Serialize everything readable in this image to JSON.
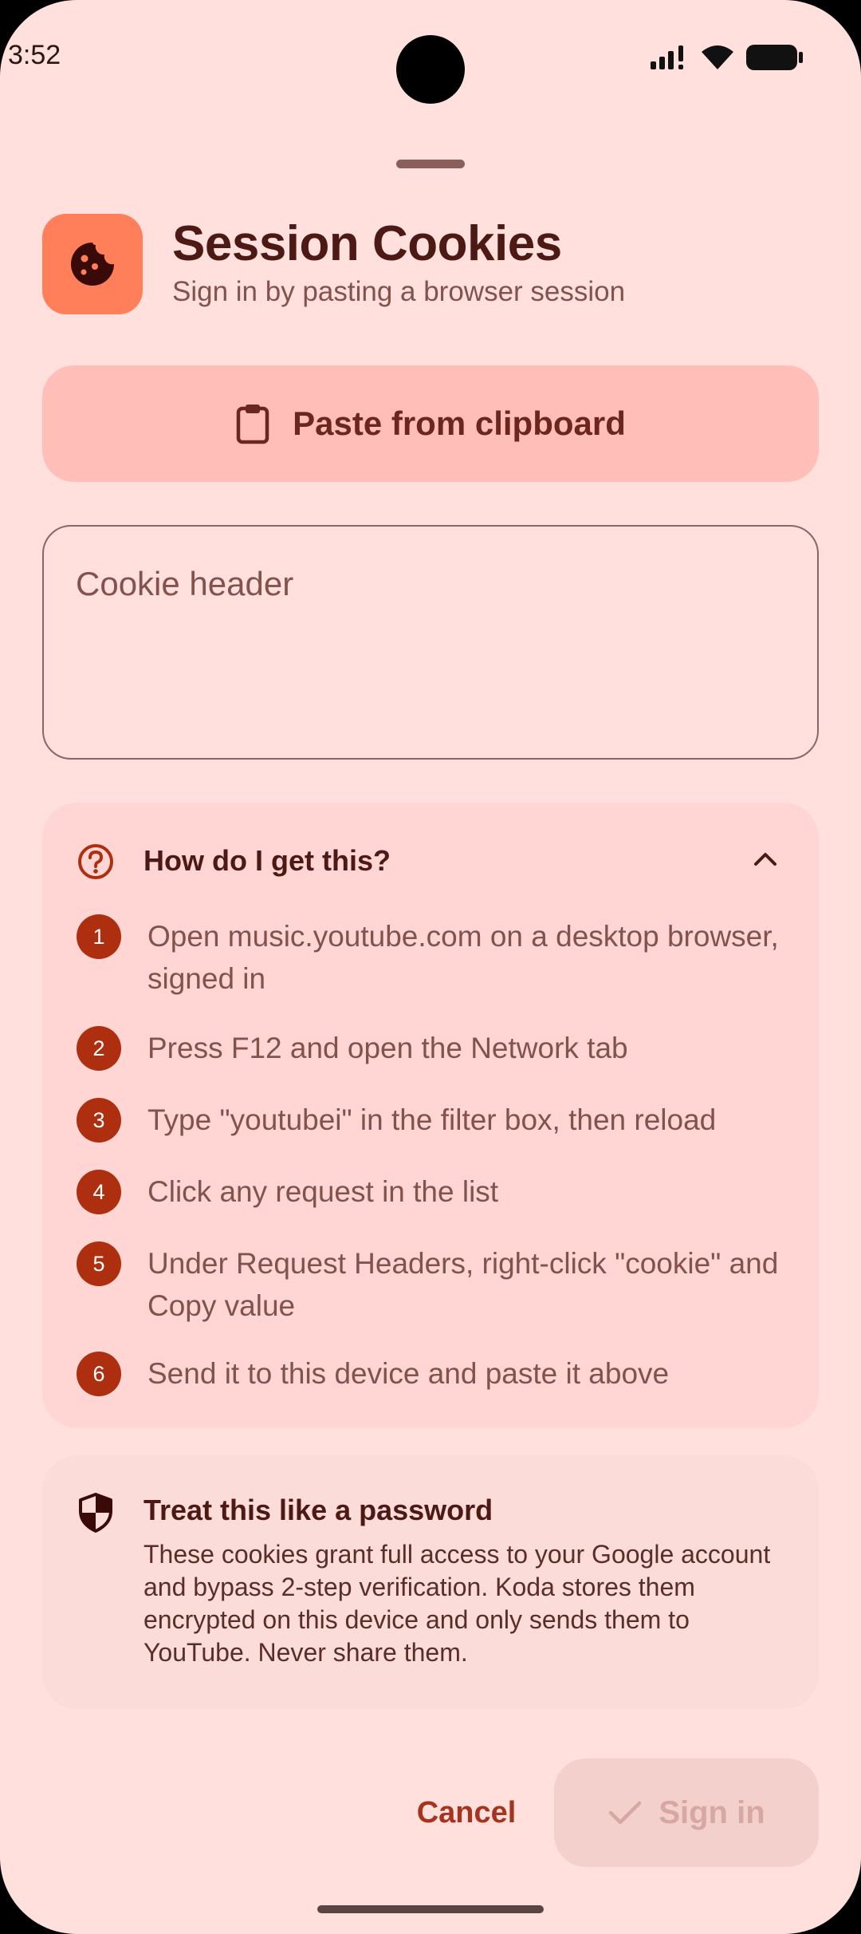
{
  "status_bar": {
    "time": "3:52"
  },
  "header": {
    "title": "Session Cookies",
    "subtitle": "Sign in by pasting a browser session",
    "icon": "cookie-icon"
  },
  "paste_button": {
    "label": "Paste from clipboard",
    "icon": "clipboard-icon"
  },
  "cookie_field": {
    "placeholder": "Cookie header",
    "value": ""
  },
  "help": {
    "title": "How do I get this?",
    "expanded": true,
    "steps": [
      {
        "num": "1",
        "text": "Open music.youtube.com on a desktop browser, signed in"
      },
      {
        "num": "2",
        "text": "Press F12 and open the Network tab"
      },
      {
        "num": "3",
        "text": "Type \"youtubei\" in the filter box, then reload"
      },
      {
        "num": "4",
        "text": "Click any request in the list"
      },
      {
        "num": "5",
        "text": "Under Request Headers, right-click \"cookie\" and Copy value"
      },
      {
        "num": "6",
        "text": "Send it to this device and paste it above"
      }
    ]
  },
  "warning": {
    "title": "Treat this like a password",
    "body": "These cookies grant full access to your Google account and bypass 2-step verification. Koda stores them encrypted on this device and only sends them to YouTube. Never share them."
  },
  "actions": {
    "cancel": "Cancel",
    "sign_in": "Sign in",
    "sign_in_enabled": false
  },
  "colors": {
    "background": "#ffe0dd",
    "accent": "#ad2f0f",
    "app_icon_bg": "#ff7f5a",
    "paste_button_bg": "#ffbeb8",
    "help_card_bg": "#ffd6d3",
    "warning_card_bg": "#fbdcd8"
  }
}
